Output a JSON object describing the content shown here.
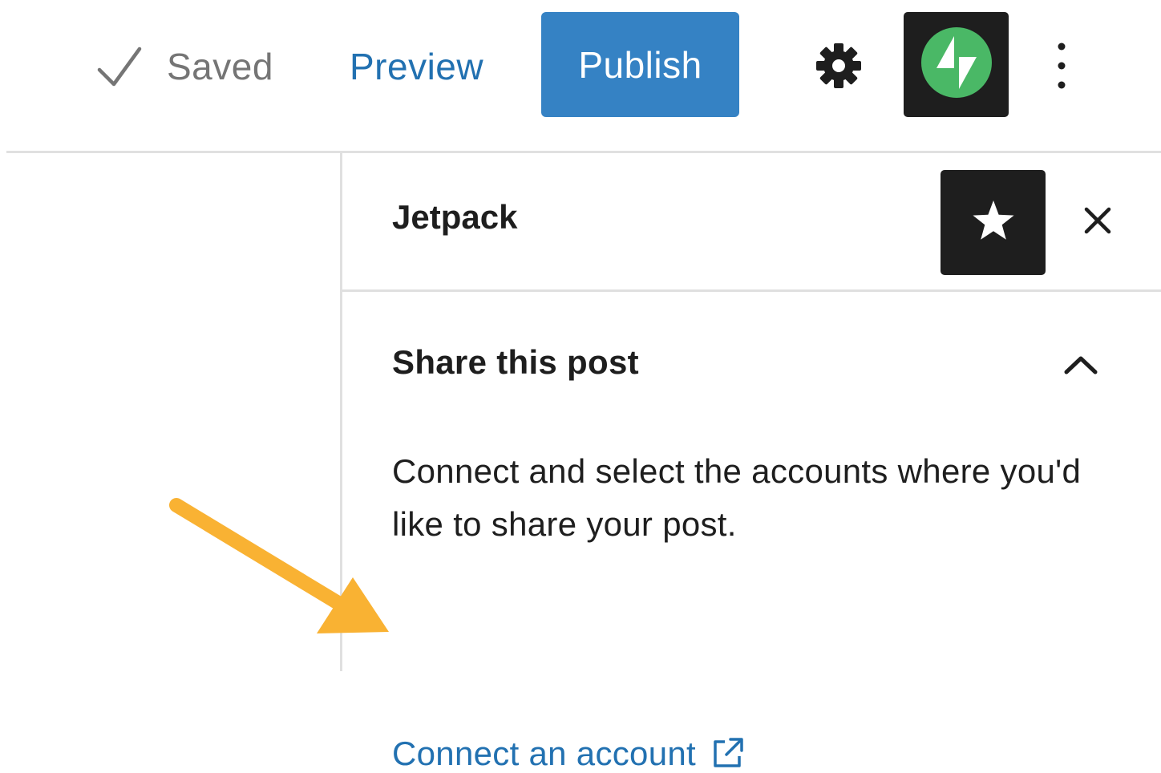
{
  "toolbar": {
    "saved_label": "Saved",
    "preview_label": "Preview",
    "publish_label": "Publish",
    "icons": {
      "check": "check-icon",
      "settings": "gear-icon",
      "jetpack": "jetpack-logo-icon",
      "more": "vertical-ellipsis-icon"
    }
  },
  "sidebar": {
    "title": "Jetpack",
    "icons": {
      "star": "star-icon",
      "close": "close-icon"
    },
    "share": {
      "title": "Share this post",
      "description": "Connect and select the accounts where you'd like to share your post.",
      "connect_label": "Connect an account",
      "toggle_icon": "chevron-up-icon",
      "link_icon": "external-link-icon"
    }
  },
  "annotation": {
    "icon": "arrow-icon",
    "color": "#f9b233"
  },
  "colors": {
    "accent": "#3582c4",
    "link": "#2271b1",
    "jetpack_green": "#4ab866",
    "dark": "#1e1e1e",
    "muted": "#757575"
  }
}
